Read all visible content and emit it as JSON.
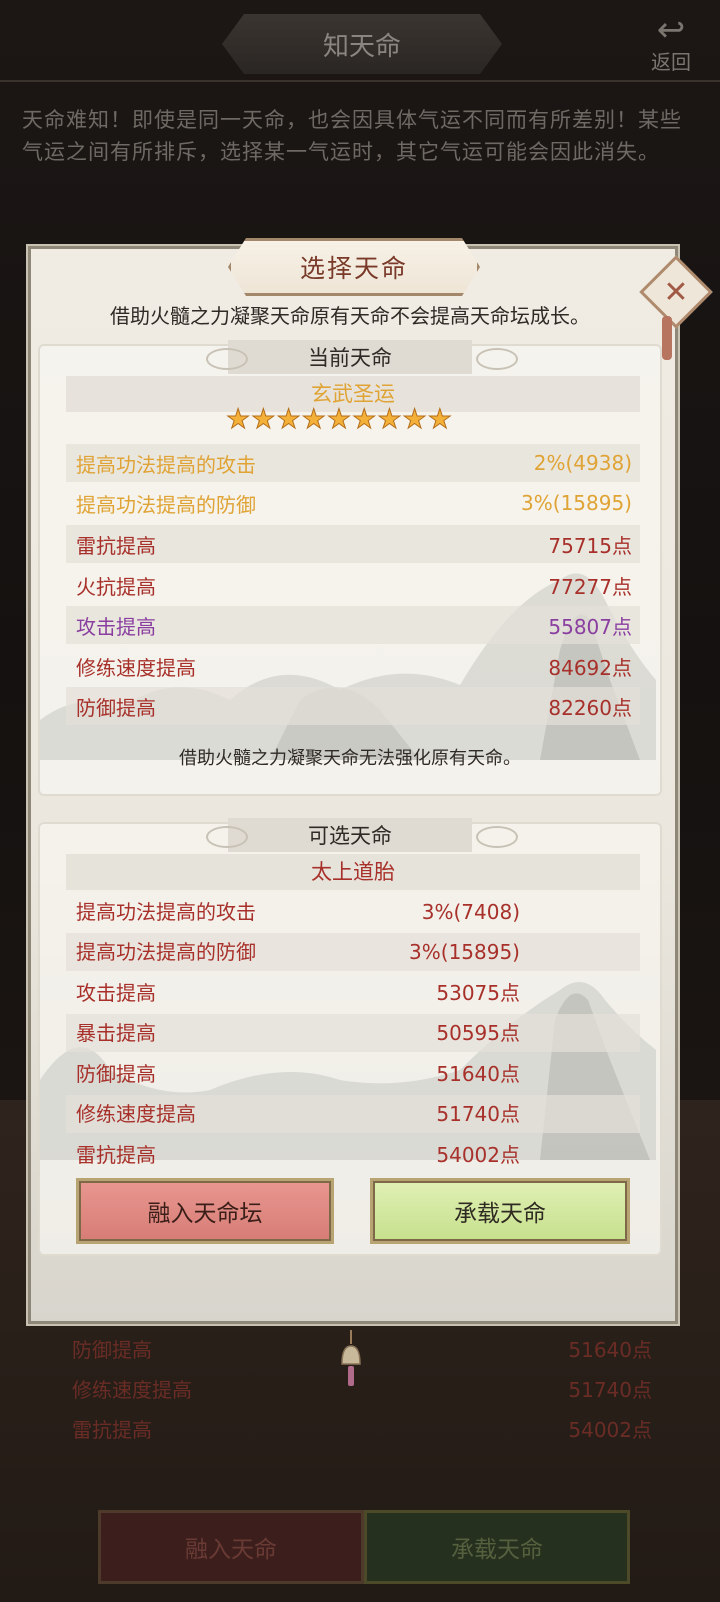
{
  "header": {
    "title": "知天命",
    "back_label": "返回"
  },
  "intro_text": "天命难知！即使是同一天命，也会因具体气运不同而有所差别！某些气运之间有所排斥，选择某一气运时，其它气运可能会因此消失。",
  "background_list": {
    "rows": [
      {
        "label": "防御提高",
        "value": "51640点"
      },
      {
        "label": "修练速度提高",
        "value": "51740点"
      },
      {
        "label": "雷抗提高",
        "value": "54002点"
      }
    ],
    "merge_label": "融入天命",
    "carry_label": "承载天命"
  },
  "modal": {
    "title": "选择天命",
    "hint_top": "借助火髓之力凝聚天命原有天命不会提高天命坛成长。",
    "current": {
      "heading": "当前天命",
      "name": "玄武圣运",
      "stars": 9,
      "stats": [
        {
          "label": "提高功法提高的攻击",
          "value": "2%(4938)",
          "color": "gold"
        },
        {
          "label": "提高功法提高的防御",
          "value": "3%(15895)",
          "color": "gold"
        },
        {
          "label": "雷抗提高",
          "value": "75715点",
          "color": "red"
        },
        {
          "label": "火抗提高",
          "value": "77277点",
          "color": "red"
        },
        {
          "label": "攻击提高",
          "value": "55807点",
          "color": "purple"
        },
        {
          "label": "修练速度提高",
          "value": "84692点",
          "color": "red"
        },
        {
          "label": "防御提高",
          "value": "82260点",
          "color": "red"
        }
      ]
    },
    "hint_mid": "借助火髓之力凝聚天命无法强化原有天命。",
    "optional": {
      "heading": "可选天命",
      "name": "太上道胎",
      "stats": [
        {
          "label": "提高功法提高的攻击",
          "value": "3%(7408)"
        },
        {
          "label": "提高功法提高的防御",
          "value": "3%(15895)"
        },
        {
          "label": "攻击提高",
          "value": "53075点"
        },
        {
          "label": "暴击提高",
          "value": "50595点"
        },
        {
          "label": "防御提高",
          "value": "51640点"
        },
        {
          "label": "修练速度提高",
          "value": "51740点"
        },
        {
          "label": "雷抗提高",
          "value": "54002点"
        }
      ]
    },
    "merge_button": "融入天命坛",
    "carry_button": "承载天命"
  },
  "colors": {
    "gold": "#e0a335",
    "red": "#a8302a",
    "purple": "#8a3fa0"
  }
}
